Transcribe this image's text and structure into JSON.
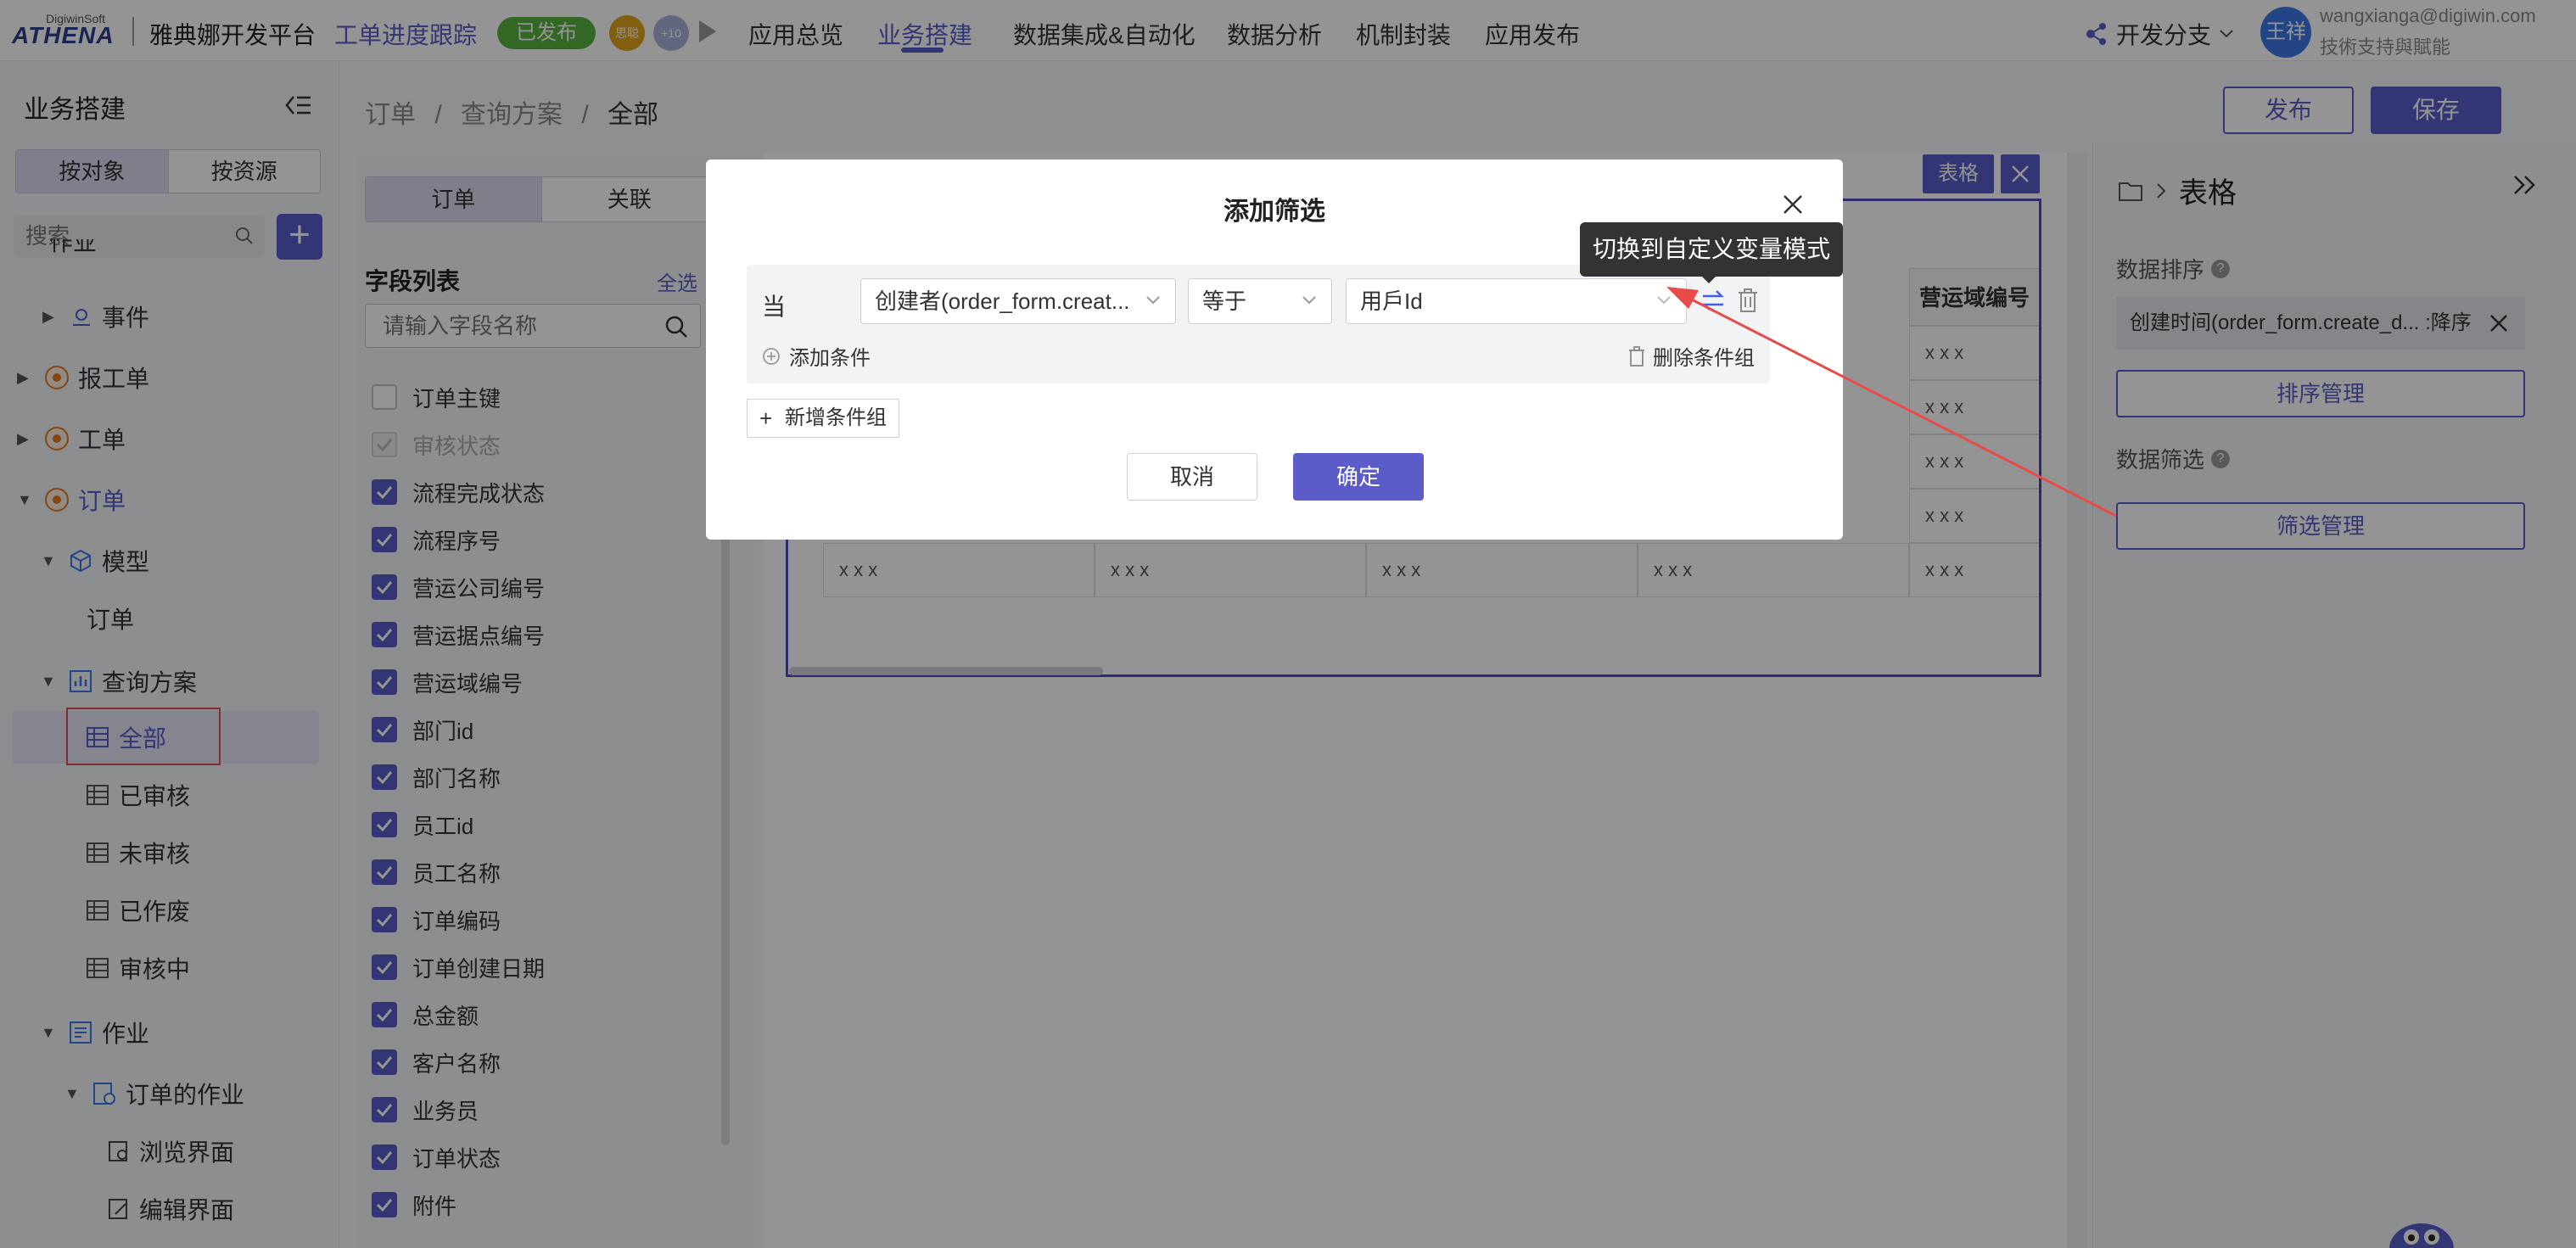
{
  "topbar": {
    "logo_top": "DigiwinSoft",
    "logo_main": "ATHENA",
    "platform": "雅典娜开发平台",
    "progress_link": "工单进度跟踪",
    "published_badge": "已发布",
    "avatar_1": "思聪",
    "avatar_2": "+10",
    "nav": [
      "应用总览",
      "业务搭建",
      "数据集成&自动化",
      "数据分析",
      "机制封装",
      "应用发布"
    ],
    "branch": "开发分支",
    "user_avatar": "王祥",
    "user_email": "wangxianga@digiwin.com",
    "user_org": "技術支持與賦能"
  },
  "sidebar": {
    "title": "业务搭建",
    "toggle": [
      "按对象",
      "按资源"
    ],
    "search_placeholder": "搜索",
    "add_label": "+",
    "tree": {
      "partial": "作业",
      "event": "事件",
      "report": "报工单",
      "workorder": "工单",
      "order": "订单",
      "model": "模型",
      "model_child": "订单",
      "query": "查询方案",
      "q_all": "全部",
      "q_approved": "已审核",
      "q_unapproved": "未审核",
      "q_void": "已作废",
      "q_reviewing": "审核中",
      "job": "作业",
      "order_job": "订单的作业",
      "browse": "浏览界面",
      "edit": "编辑界面"
    }
  },
  "breadcrumb": {
    "items": [
      "订单",
      "/",
      "查询方案",
      "/",
      "全部"
    ]
  },
  "header_buttons": {
    "publish": "发布",
    "save": "保存"
  },
  "field_panel": {
    "tabs": [
      "订单",
      "关联"
    ],
    "title": "字段列表",
    "select_all": "全选",
    "search_placeholder": "请输入字段名称",
    "fields": [
      {
        "label": "订单主键",
        "state": "off"
      },
      {
        "label": "审核状态",
        "state": "dis"
      },
      {
        "label": "流程完成状态",
        "state": "on"
      },
      {
        "label": "流程序号",
        "state": "on"
      },
      {
        "label": "营运公司编号",
        "state": "on"
      },
      {
        "label": "营运据点编号",
        "state": "on"
      },
      {
        "label": "营运域编号",
        "state": "on"
      },
      {
        "label": "部门id",
        "state": "on"
      },
      {
        "label": "部门名称",
        "state": "on"
      },
      {
        "label": "员工id",
        "state": "on"
      },
      {
        "label": "员工名称",
        "state": "on"
      },
      {
        "label": "订单编码",
        "state": "on"
      },
      {
        "label": "订单创建日期",
        "state": "on"
      },
      {
        "label": "总金额",
        "state": "on"
      },
      {
        "label": "客户名称",
        "state": "on"
      },
      {
        "label": "业务员",
        "state": "on"
      },
      {
        "label": "订单状态",
        "state": "on"
      },
      {
        "label": "附件",
        "state": "on"
      }
    ]
  },
  "canvas": {
    "table_tag": "表格",
    "column_header": "营运域编号",
    "cell_value": "x x x"
  },
  "right_panel": {
    "title": "表格",
    "sort_label": "数据排序",
    "sort_item": "创建时间(order_form.create_d... :降序",
    "sort_manage": "排序管理",
    "filter_label": "数据筛选",
    "filter_manage": "筛选管理",
    "help": "?"
  },
  "modal": {
    "title": "添加筛选",
    "when": "当",
    "field_value": "创建者(order_form.creat...",
    "operator_value": "等于",
    "value_value": "用戶Id",
    "add_condition": "添加条件",
    "delete_group": "删除条件组",
    "new_group": "新增条件组",
    "new_group_plus": "+",
    "cancel": "取消",
    "confirm": "确定",
    "tooltip": "切换到自定义变量模式"
  },
  "colors": {
    "accent": "#5b5cc8",
    "published": "#58b33f",
    "annotation": "#e94a4a"
  }
}
